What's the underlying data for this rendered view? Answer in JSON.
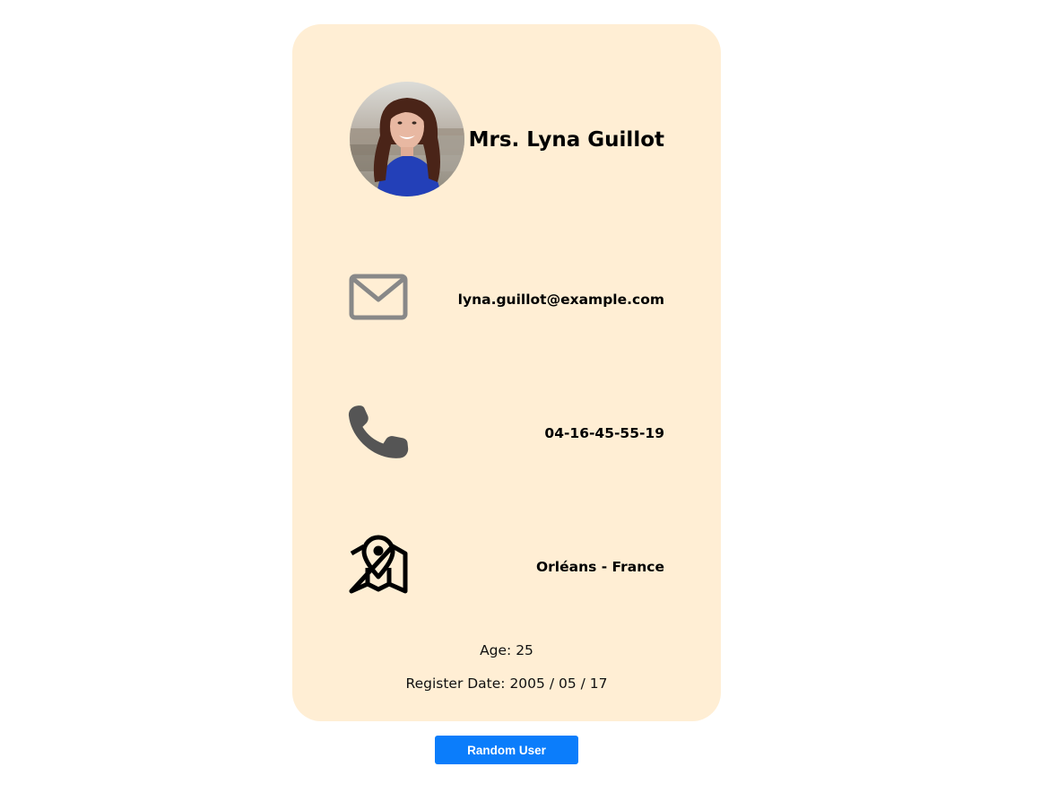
{
  "user": {
    "name": "Mrs. Lyna Guillot",
    "email": "lyna.guillot@example.com",
    "phone": "04-16-45-55-19",
    "location": "Orléans - France",
    "age_text": "Age: 25",
    "register_text": "Register Date: 2005 / 05 / 17"
  },
  "icons": {
    "email": "envelope-icon",
    "phone": "phone-icon",
    "location": "map-pin-icon"
  },
  "actions": {
    "random_label": "Random User"
  },
  "colors": {
    "card_bg": "#ffeed4",
    "button_bg": "#0b7dfb",
    "envelope_icon": "#888888",
    "phone_icon": "#555555",
    "map_icon": "#000000"
  }
}
